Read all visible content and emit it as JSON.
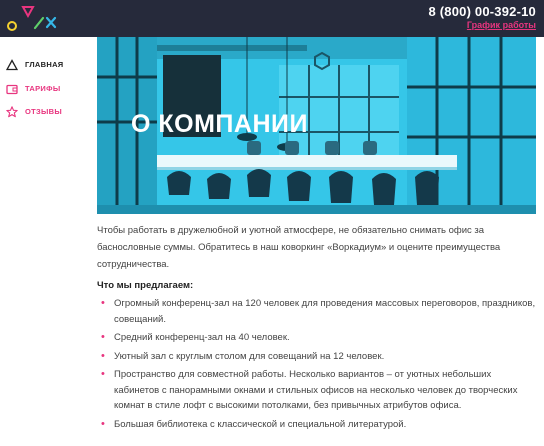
{
  "header": {
    "phone": "8 (800) 00-392-10",
    "schedule_link": "График работы"
  },
  "sidebar": {
    "items": [
      {
        "label": "ГЛАВНАЯ",
        "icon": "home-triangle-icon"
      },
      {
        "label": "ТАРИФЫ",
        "icon": "wallet-icon"
      },
      {
        "label": "ОТЗЫВЫ",
        "icon": "star-icon"
      }
    ]
  },
  "hero": {
    "title": "О КОМПАНИИ"
  },
  "content": {
    "intro": "Чтобы работать в дружелюбной и уютной атмосфере, не обязательно снимать офис за баснословные суммы. Обратитесь в наш коворкинг «Воркадиум» и оцените преимущества сотрудничества.",
    "offer_title": "Что мы предлагаем:",
    "items": [
      "Огромный конференц-зал на 120 человек для проведения массовых переговоров, праздников, совещаний.",
      "Средний конференц-зал на 40 человек.",
      "Уютный зал с круглым столом для совещаний на 12 человек.",
      "Пространство для совместной работы. Несколько вариантов – от уютных небольших кабинетов с панорамными окнами и стильных офисов на несколько человек до творческих комнат в стиле лофт с высокими потолками, без привычных атрибутов офиса.",
      "Большая библиотека с классической и специальной литературой."
    ]
  },
  "colors": {
    "topbar": "#262a3b",
    "accent": "#e8357f",
    "hero_tint": "#35c6e8"
  }
}
